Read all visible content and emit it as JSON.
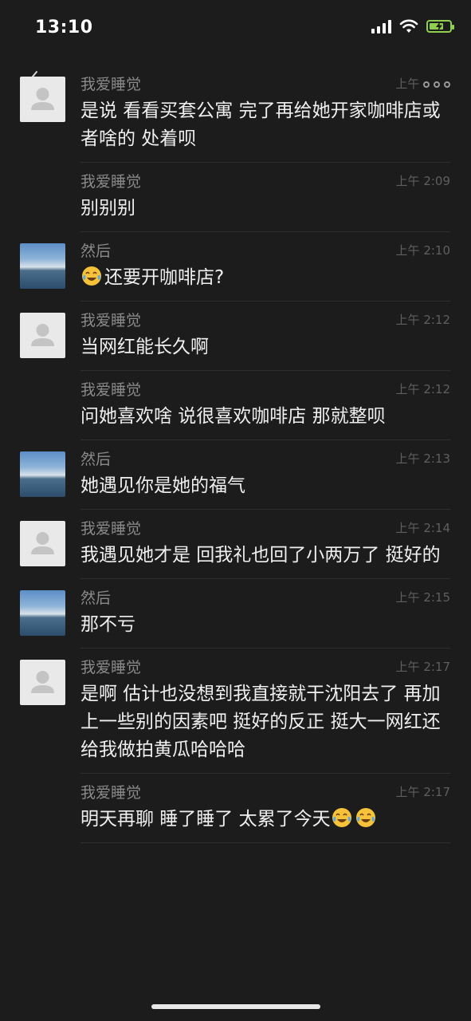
{
  "status_bar": {
    "time": "13:10",
    "battery_level": 0.7,
    "charging": true,
    "icons": [
      "signal-icon",
      "wifi-icon",
      "battery-charging-icon"
    ]
  },
  "colors": {
    "background": "#1c1c1c",
    "text": "#efefef",
    "name": "#8a8a8a",
    "time": "#5f5f5f",
    "battery": "#8fd14f"
  },
  "messages": [
    {
      "sender": "我爱睡觉",
      "time": "上午",
      "text": "是说 看看买套公寓 完了再给她开家咖啡店或者啥的 处着呗",
      "avatar": "default"
    },
    {
      "sender": "我爱睡觉",
      "time": "上午 2:09",
      "text": "别别别",
      "avatar": "none"
    },
    {
      "sender": "然后",
      "time": "上午 2:10",
      "text": "还要开咖啡店?",
      "avatar": "photo",
      "emoji": "laugh-cry-emoji"
    },
    {
      "sender": "我爱睡觉",
      "time": "上午 2:12",
      "text": "当网红能长久啊",
      "avatar": "default"
    },
    {
      "sender": "我爱睡觉",
      "time": "上午 2:12",
      "text": "问她喜欢啥 说很喜欢咖啡店 那就整呗",
      "avatar": "none"
    },
    {
      "sender": "然后",
      "time": "上午 2:13",
      "text": "她遇见你是她的福气",
      "avatar": "photo"
    },
    {
      "sender": "我爱睡觉",
      "time": "上午 2:14",
      "text": "我遇见她才是 回我礼也回了小两万了 挺好的",
      "avatar": "default"
    },
    {
      "sender": "然后",
      "time": "上午 2:15",
      "text": "那不亏",
      "avatar": "photo"
    },
    {
      "sender": "我爱睡觉",
      "time": "上午 2:17",
      "text": "是啊 估计也没想到我直接就干沈阳去了 再加上一些别的因素吧 挺好的反正 挺大一网红还给我做拍黄瓜哈哈哈",
      "avatar": "default"
    },
    {
      "sender": "我爱睡觉",
      "time": "上午 2:17",
      "text": "明天再聊 睡了睡了 太累了今天",
      "avatar": "none",
      "trailing_emoji": [
        "laugh-cry-emoji",
        "laugh-cry-emoji"
      ]
    }
  ]
}
